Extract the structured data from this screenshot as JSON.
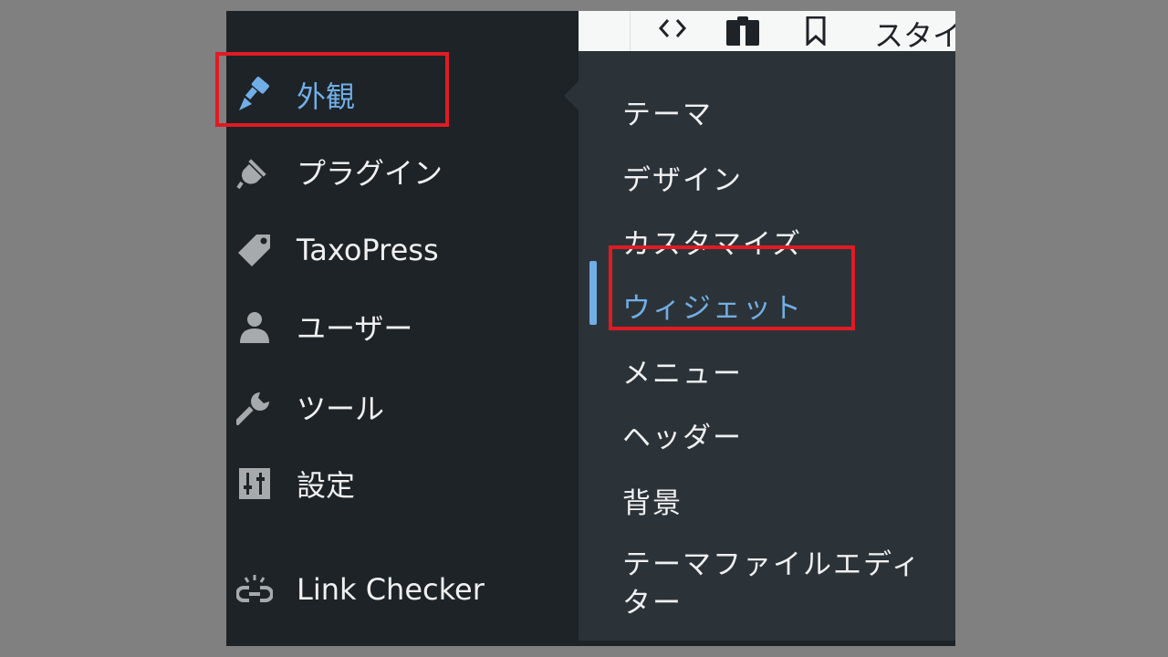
{
  "admin_menu": {
    "items": [
      {
        "label": "外観",
        "icon": "paintbrush-icon",
        "current": true
      },
      {
        "label": "プラグイン",
        "icon": "plugin-icon"
      },
      {
        "label": "TaxoPress",
        "icon": "tag-icon"
      },
      {
        "label": "ユーザー",
        "icon": "user-icon"
      },
      {
        "label": "ツール",
        "icon": "wrench-icon"
      },
      {
        "label": "設定",
        "icon": "settings-sliders-icon"
      },
      {
        "label": "Link Checker",
        "icon": "broken-link-icon"
      }
    ]
  },
  "submenu": {
    "items": [
      {
        "label": "テーマ"
      },
      {
        "label": "デザイン"
      },
      {
        "label": "カスタマイズ"
      },
      {
        "label": "ウィジェット",
        "current": true
      },
      {
        "label": "メニュー"
      },
      {
        "label": "ヘッダー"
      },
      {
        "label": "背景"
      },
      {
        "label": "テーマファイルエディター",
        "line1": "テーマファイルエディ",
        "line2": "ター"
      }
    ]
  },
  "toolbar": {
    "icons": [
      "code-icon",
      "clipboard-icon",
      "bookmark-icon"
    ],
    "style_text": "スタイ"
  },
  "colors": {
    "sidebar_bg": "#1d2327",
    "submenu_bg": "#2c3338",
    "accent": "#72aee6",
    "highlight_box": "#e01b24",
    "page_bg": "#808080"
  }
}
